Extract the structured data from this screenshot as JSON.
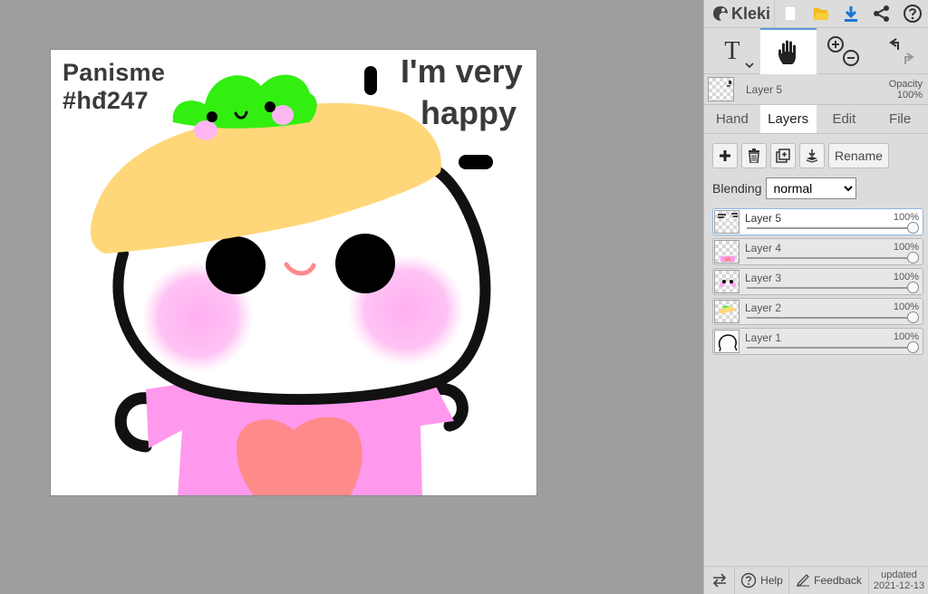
{
  "canvas": {
    "text_line1": "Panisme",
    "text_line2": "#hđ247",
    "speech_line1": "I'm very",
    "speech_line2": "happy"
  },
  "topbar": {
    "brand": "Kleki",
    "icons": [
      "kleki-logo-icon",
      "new-file-icon",
      "open-folder-icon",
      "download-icon",
      "share-icon",
      "help-icon"
    ]
  },
  "tools": {
    "text_tool": "T",
    "items": [
      "text-tool",
      "hand-tool",
      "zoom-tool",
      "undo-redo-tool"
    ]
  },
  "current_layer": {
    "name": "Layer 5",
    "opacity_label": "Opacity",
    "opacity_value": "100%"
  },
  "tabs": [
    {
      "label": "Hand",
      "active": false
    },
    {
      "label": "Layers",
      "active": true
    },
    {
      "label": "Edit",
      "active": false
    },
    {
      "label": "File",
      "active": false
    }
  ],
  "layers_panel": {
    "rename_label": "Rename",
    "blending_label": "Blending",
    "blending_value": "normal",
    "layers": [
      {
        "name": "Layer 5",
        "opacity": "100%",
        "opacity_fraction": 1.0,
        "selected": true
      },
      {
        "name": "Layer 4",
        "opacity": "100%",
        "opacity_fraction": 1.0,
        "selected": false
      },
      {
        "name": "Layer 3",
        "opacity": "100%",
        "opacity_fraction": 1.0,
        "selected": false
      },
      {
        "name": "Layer 2",
        "opacity": "100%",
        "opacity_fraction": 1.0,
        "selected": false
      },
      {
        "name": "Layer 1",
        "opacity": "100%",
        "opacity_fraction": 1.0,
        "selected": false
      }
    ]
  },
  "bottombar": {
    "help_label": "Help",
    "feedback_label": "Feedback",
    "updated_label": "updated",
    "updated_date": "2021-12-13"
  },
  "colors": {
    "accent": "#5a9bd4",
    "panel_bg": "#dcdcdc",
    "workspace_bg": "#9e9e9e",
    "hat": "#ffd77a",
    "leaf": "#33ee11",
    "shirt": "#ff99ee",
    "heart": "#ff8a8a",
    "blush": "#ffb6f0"
  }
}
